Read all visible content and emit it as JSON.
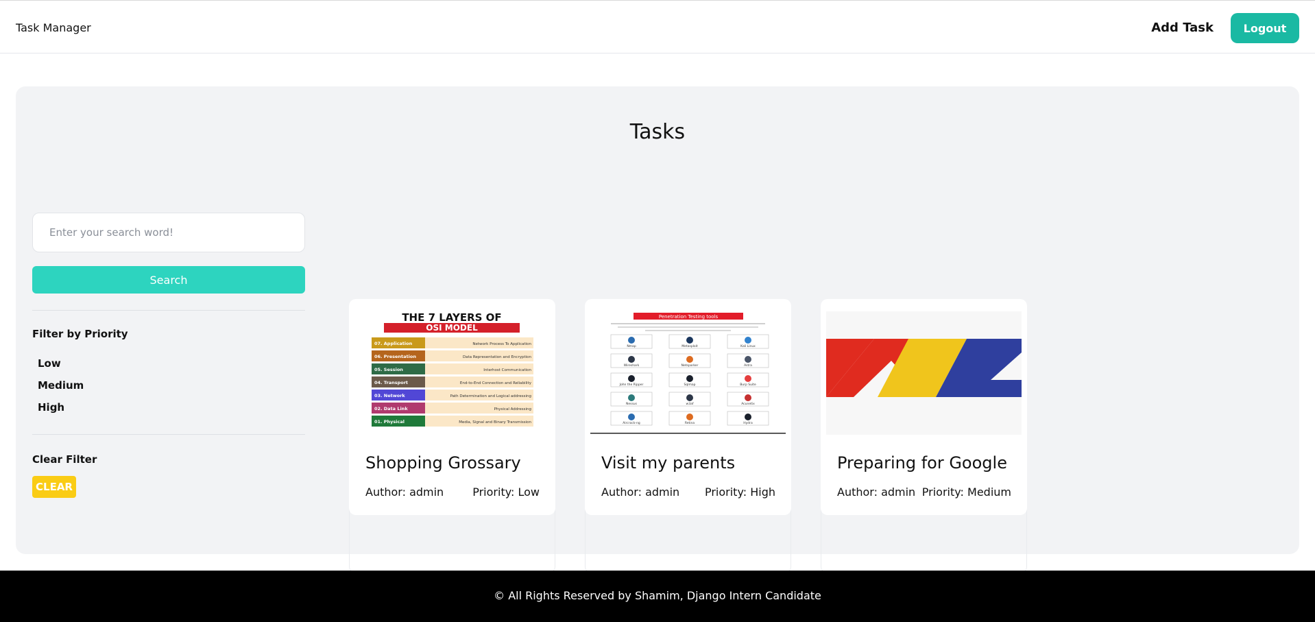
{
  "app": {
    "title": "Task Manager"
  },
  "nav": {
    "add_task": "Add Task",
    "logout": "Logout"
  },
  "page": {
    "title": "Tasks"
  },
  "sidebar": {
    "search_placeholder": "Enter your search word!",
    "search_button": "Search",
    "filter_title": "Filter by Priority",
    "filters": [
      "Low",
      "Medium",
      "High"
    ],
    "clear_title": "Clear Filter",
    "clear_button": "CLEAR"
  },
  "tasks": [
    {
      "title": "Shopping Grossary",
      "author": "Author: admin",
      "priority": "Priority: Low",
      "image": "osi-model-infographic",
      "image_heading_top": "THE 7 LAYERS OF",
      "image_heading_bottom": "OSI MODEL",
      "layers": [
        {
          "name": "07. Application",
          "desc": "Network Process To Application",
          "color": "#c99a1a"
        },
        {
          "name": "06. Presentation",
          "desc": "Data Representation and Encryption",
          "color": "#b5651d"
        },
        {
          "name": "05. Session",
          "desc": "Interhost Communication",
          "color": "#2e6b46"
        },
        {
          "name": "04. Transport",
          "desc": "End-to-End Connection and Reliability",
          "color": "#6b5a4a"
        },
        {
          "name": "03. Network",
          "desc": "Path Determination and Logical addressing",
          "color": "#5147d6"
        },
        {
          "name": "02. Data Link",
          "desc": "Physical Addressing",
          "color": "#b03a6e"
        },
        {
          "name": "01. Physical",
          "desc": "Media, Signal and Binary Transmission",
          "color": "#1f7a3a"
        }
      ]
    },
    {
      "title": "Visit my parents",
      "author": "Author: admin",
      "priority": "Priority: High",
      "image": "penetration-testing-tools",
      "image_heading": "Penetration Testing tools",
      "tools": [
        "Nmap",
        "Metasploit",
        "Kali Linux",
        "Wireshark",
        "Netsparker",
        "Astra",
        "John the Ripper",
        "Sqlmap",
        "Burp Suite",
        "Nessus",
        "w3af",
        "Acunetix",
        "Aircrack-ng",
        "Retina",
        "Hydra"
      ]
    },
    {
      "title": "Preparing for Google",
      "author": "Author: admin",
      "priority": "Priority: Medium",
      "image": "red-yellow-blue-logo"
    }
  ],
  "footer": {
    "text": "© All Rights Reserved by Shamim, Django Intern Candidate"
  },
  "colors": {
    "accent": "#1ab9a3",
    "search": "#2dd4bf",
    "clear": "#facc15",
    "panel": "#f2f3f5",
    "footer": "#000000"
  }
}
